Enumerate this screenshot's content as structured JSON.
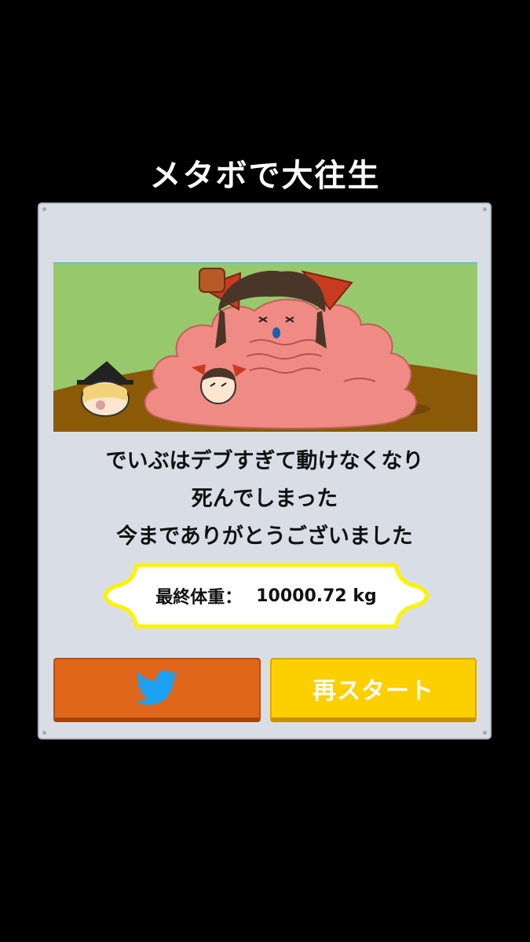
{
  "title": "メタボで大往生",
  "message": {
    "line1": "でいぶはデブすぎて動けなくなり",
    "line2": "死んでしまった",
    "line3": "今までありがとうございました"
  },
  "result": {
    "label": "最終体重：",
    "value": "10000.72 kg"
  },
  "buttons": {
    "twitter_icon": "twitter-bird-icon",
    "restart_label": "再スタート"
  },
  "colors": {
    "background": "#000000",
    "panel": "#d9dee6",
    "badge_border": "#fff200",
    "twitter_button": "#e0661a",
    "restart_button": "#fccf00",
    "twitter_bird": "#1da1f2"
  }
}
